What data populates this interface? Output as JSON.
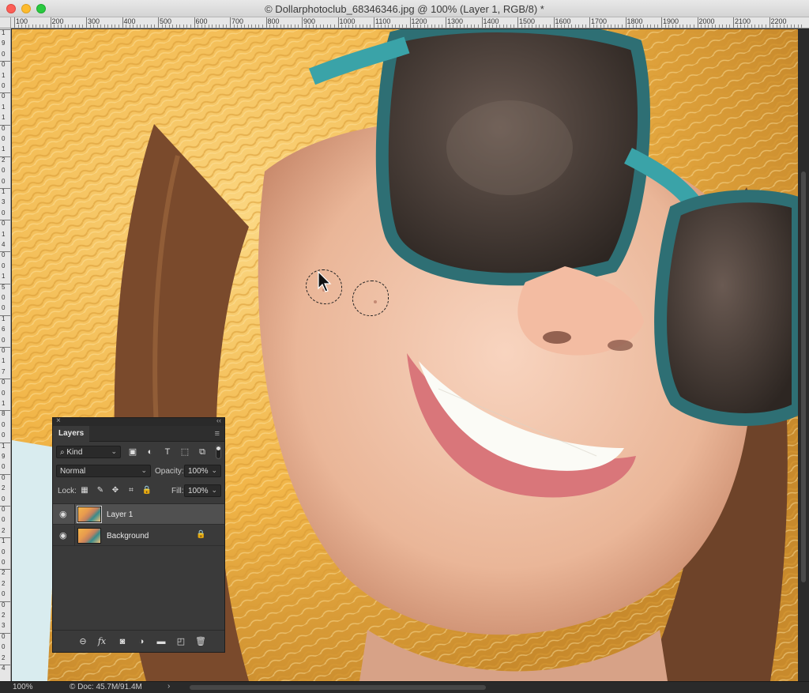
{
  "window": {
    "title": "© Dollarphotoclub_68346346.jpg @ 100% (Layer 1, RGB/8) *"
  },
  "ruler": {
    "top_labels": [
      "100",
      "200",
      "300",
      "400",
      "500",
      "600",
      "700",
      "800",
      "900",
      "1000",
      "1100",
      "1200",
      "1300",
      "1400",
      "1500",
      "1600",
      "1700",
      "1800",
      "1900",
      "2000",
      "2100",
      "2200"
    ],
    "left_labels": [
      "1",
      "9",
      "0",
      "0",
      "1",
      "0",
      "0",
      "1",
      "1",
      "0",
      "0",
      "1",
      "2",
      "0",
      "0",
      "1",
      "3",
      "0",
      "0",
      "1",
      "4",
      "0",
      "0",
      "1",
      "5",
      "0",
      "0",
      "1",
      "6",
      "0",
      "0",
      "1",
      "7",
      "0",
      "0",
      "1",
      "8",
      "0",
      "0",
      "1",
      "9",
      "0",
      "0",
      "2",
      "0",
      "0",
      "0",
      "2",
      "1",
      "0",
      "0",
      "2",
      "2",
      "0",
      "0",
      "2",
      "3",
      "0",
      "0",
      "2",
      "4"
    ]
  },
  "status": {
    "zoom": "100%",
    "doc": "© Doc: 45.7M/91.4M",
    "arrow": "›"
  },
  "layers_panel": {
    "close": "×",
    "collapse": "‹‹",
    "tab": "Layers",
    "menu": "≡",
    "filter_kind": "Kind",
    "filter_kind_arrow": "⌄",
    "filter_search_glyph": "⌕",
    "filter_icons": [
      {
        "name": "pixel-filter-icon",
        "glyph": "▣"
      },
      {
        "name": "adjustment-filter-icon",
        "glyph": "◐"
      },
      {
        "name": "type-filter-icon",
        "glyph": "T"
      },
      {
        "name": "shape-filter-icon",
        "glyph": "⬚"
      },
      {
        "name": "smart-object-filter-icon",
        "glyph": "⧉"
      }
    ],
    "blend_mode": "Normal",
    "opacity_label": "Opacity:",
    "opacity_value": "100%",
    "lock_label": "Lock:",
    "lock_icons": [
      {
        "name": "lock-transparent-icon",
        "glyph": "▦"
      },
      {
        "name": "lock-image-icon",
        "glyph": "✎"
      },
      {
        "name": "lock-position-icon",
        "glyph": "✥"
      },
      {
        "name": "lock-artboard-icon",
        "glyph": "⌗"
      },
      {
        "name": "lock-all-icon",
        "glyph": "🔒"
      }
    ],
    "fill_label": "Fill:",
    "fill_value": "100%",
    "layers": [
      {
        "name": "Layer 1",
        "selected": true,
        "locked": false
      },
      {
        "name": "Background",
        "selected": false,
        "locked": true
      }
    ],
    "eye_glyph": "◉",
    "layer_lock_glyph": "🔒",
    "footer_icons": [
      {
        "name": "link-layers-icon",
        "glyph": "⊖"
      },
      {
        "name": "layer-style-icon",
        "glyph": "fx"
      },
      {
        "name": "add-mask-icon",
        "glyph": "◙"
      },
      {
        "name": "adjustment-layer-icon",
        "glyph": "◑"
      },
      {
        "name": "new-group-icon",
        "glyph": "▬"
      },
      {
        "name": "new-layer-icon",
        "glyph": "◰"
      },
      {
        "name": "delete-layer-icon",
        "glyph": "🗑"
      }
    ]
  },
  "colors": {
    "hat": "#f4b94a",
    "glasses_frame": "#3aa3a8",
    "skin": "#f3c6ad"
  }
}
